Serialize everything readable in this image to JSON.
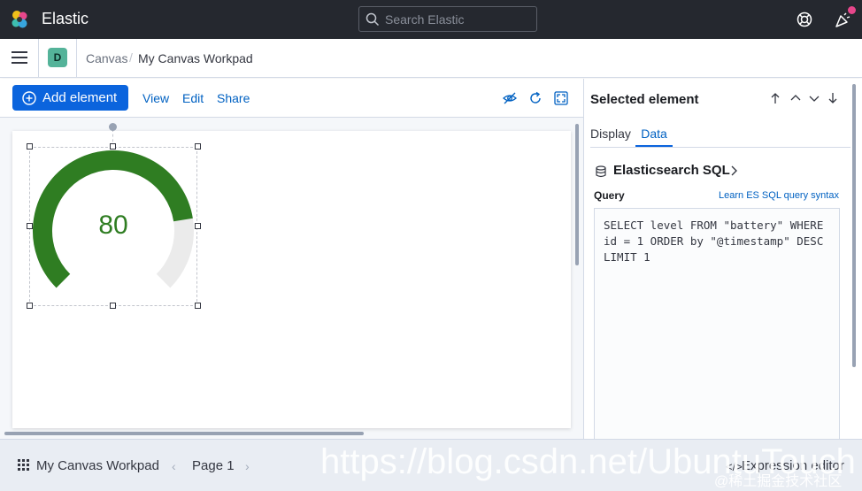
{
  "app": {
    "brand": "Elastic"
  },
  "header": {
    "search_placeholder": "Search Elastic"
  },
  "breadcrumb": {
    "space_initial": "D",
    "items": [
      "Canvas",
      "My Canvas Workpad"
    ],
    "separator": "/"
  },
  "toolbar": {
    "add_element": "Add element",
    "links": [
      "View",
      "Edit",
      "Share"
    ]
  },
  "canvas": {
    "element": {
      "type": "gauge",
      "value": "80",
      "fraction": 0.8,
      "fill_color": "#2f7d22",
      "track_color": "#ebebeb"
    }
  },
  "panel": {
    "title": "Selected element",
    "tabs": [
      "Display",
      "Data"
    ],
    "active_tab": "Data",
    "datasource": "Elasticsearch SQL",
    "query_label": "Query",
    "query_help_link": "Learn ES SQL query syntax",
    "query": "SELECT level FROM \"battery\" WHERE\nid = 1 ORDER by \"@timestamp\" DESC\nLIMIT 1"
  },
  "footer": {
    "workpad_title": "My Canvas Workpad",
    "page_label": "Page 1",
    "expression_editor": "Expression editor"
  },
  "watermark": {
    "url": "https://blog.csdn.net/UbuntuTouch",
    "cn": "@稀土掘金技术社区"
  },
  "icons": {
    "logo": "elastic-logo-icon",
    "search": "search-icon",
    "help": "help-icon",
    "news": "newsfeed-icon",
    "menu": "menu-icon",
    "add": "plus-circle-icon",
    "hide": "eye-closed-icon",
    "refresh": "refresh-icon",
    "fullscreen": "fullscreen-icon",
    "database": "database-icon",
    "grid": "grid-icon",
    "code": "code-icon"
  }
}
